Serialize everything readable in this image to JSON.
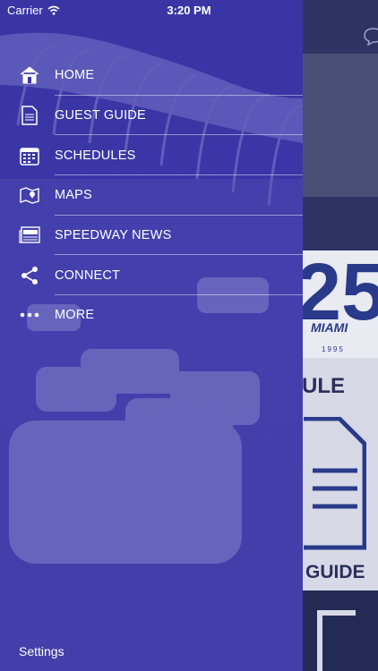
{
  "status_bar": {
    "carrier": "Carrier",
    "time": "3:20 PM"
  },
  "menu": {
    "items": [
      {
        "label": "HOME",
        "icon": "home-icon"
      },
      {
        "label": "GUEST GUIDE",
        "icon": "document-icon"
      },
      {
        "label": "SCHEDULES",
        "icon": "calendar-icon"
      },
      {
        "label": "MAPS",
        "icon": "map-icon"
      },
      {
        "label": "SPEEDWAY NEWS",
        "icon": "newspaper-icon"
      },
      {
        "label": "CONNECT",
        "icon": "share-icon"
      },
      {
        "label": "MORE",
        "icon": "more-icon"
      }
    ],
    "settings_label": "Settings"
  },
  "background_content": {
    "logo_number": "25",
    "logo_brand": "MIAMI",
    "logo_year": "1995",
    "schedule_fragment": "ULE",
    "guide_fragment": "GUIDE"
  },
  "colors": {
    "drawer": "#3b36a8",
    "background": "#2d3464",
    "text": "#ffffff"
  }
}
